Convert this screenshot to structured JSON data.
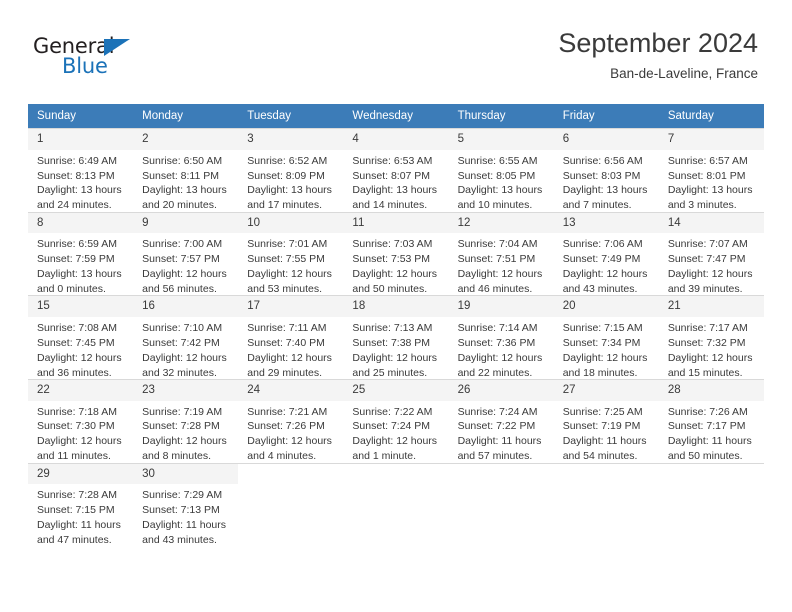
{
  "brand": {
    "name_part1": "General",
    "name_part2": "Blue",
    "triangle_color": "#1b72b8"
  },
  "header": {
    "title": "September 2024",
    "subtitle": "Ban-de-Laveline, France"
  },
  "colors": {
    "header_row_bg": "#3c7cb8",
    "header_row_text": "#ffffff",
    "daynum_bg": "#f4f4f4",
    "cell_text": "#3a3a3a",
    "grid_line": "#d9d9d9"
  },
  "weekdays": [
    "Sunday",
    "Monday",
    "Tuesday",
    "Wednesday",
    "Thursday",
    "Friday",
    "Saturday"
  ],
  "weeks": [
    [
      {
        "day": "1",
        "sunrise": "Sunrise: 6:49 AM",
        "sunset": "Sunset: 8:13 PM",
        "daylight_line1": "Daylight: 13 hours",
        "daylight_line2": "and 24 minutes."
      },
      {
        "day": "2",
        "sunrise": "Sunrise: 6:50 AM",
        "sunset": "Sunset: 8:11 PM",
        "daylight_line1": "Daylight: 13 hours",
        "daylight_line2": "and 20 minutes."
      },
      {
        "day": "3",
        "sunrise": "Sunrise: 6:52 AM",
        "sunset": "Sunset: 8:09 PM",
        "daylight_line1": "Daylight: 13 hours",
        "daylight_line2": "and 17 minutes."
      },
      {
        "day": "4",
        "sunrise": "Sunrise: 6:53 AM",
        "sunset": "Sunset: 8:07 PM",
        "daylight_line1": "Daylight: 13 hours",
        "daylight_line2": "and 14 minutes."
      },
      {
        "day": "5",
        "sunrise": "Sunrise: 6:55 AM",
        "sunset": "Sunset: 8:05 PM",
        "daylight_line1": "Daylight: 13 hours",
        "daylight_line2": "and 10 minutes."
      },
      {
        "day": "6",
        "sunrise": "Sunrise: 6:56 AM",
        "sunset": "Sunset: 8:03 PM",
        "daylight_line1": "Daylight: 13 hours",
        "daylight_line2": "and 7 minutes."
      },
      {
        "day": "7",
        "sunrise": "Sunrise: 6:57 AM",
        "sunset": "Sunset: 8:01 PM",
        "daylight_line1": "Daylight: 13 hours",
        "daylight_line2": "and 3 minutes."
      }
    ],
    [
      {
        "day": "8",
        "sunrise": "Sunrise: 6:59 AM",
        "sunset": "Sunset: 7:59 PM",
        "daylight_line1": "Daylight: 13 hours",
        "daylight_line2": "and 0 minutes."
      },
      {
        "day": "9",
        "sunrise": "Sunrise: 7:00 AM",
        "sunset": "Sunset: 7:57 PM",
        "daylight_line1": "Daylight: 12 hours",
        "daylight_line2": "and 56 minutes."
      },
      {
        "day": "10",
        "sunrise": "Sunrise: 7:01 AM",
        "sunset": "Sunset: 7:55 PM",
        "daylight_line1": "Daylight: 12 hours",
        "daylight_line2": "and 53 minutes."
      },
      {
        "day": "11",
        "sunrise": "Sunrise: 7:03 AM",
        "sunset": "Sunset: 7:53 PM",
        "daylight_line1": "Daylight: 12 hours",
        "daylight_line2": "and 50 minutes."
      },
      {
        "day": "12",
        "sunrise": "Sunrise: 7:04 AM",
        "sunset": "Sunset: 7:51 PM",
        "daylight_line1": "Daylight: 12 hours",
        "daylight_line2": "and 46 minutes."
      },
      {
        "day": "13",
        "sunrise": "Sunrise: 7:06 AM",
        "sunset": "Sunset: 7:49 PM",
        "daylight_line1": "Daylight: 12 hours",
        "daylight_line2": "and 43 minutes."
      },
      {
        "day": "14",
        "sunrise": "Sunrise: 7:07 AM",
        "sunset": "Sunset: 7:47 PM",
        "daylight_line1": "Daylight: 12 hours",
        "daylight_line2": "and 39 minutes."
      }
    ],
    [
      {
        "day": "15",
        "sunrise": "Sunrise: 7:08 AM",
        "sunset": "Sunset: 7:45 PM",
        "daylight_line1": "Daylight: 12 hours",
        "daylight_line2": "and 36 minutes."
      },
      {
        "day": "16",
        "sunrise": "Sunrise: 7:10 AM",
        "sunset": "Sunset: 7:42 PM",
        "daylight_line1": "Daylight: 12 hours",
        "daylight_line2": "and 32 minutes."
      },
      {
        "day": "17",
        "sunrise": "Sunrise: 7:11 AM",
        "sunset": "Sunset: 7:40 PM",
        "daylight_line1": "Daylight: 12 hours",
        "daylight_line2": "and 29 minutes."
      },
      {
        "day": "18",
        "sunrise": "Sunrise: 7:13 AM",
        "sunset": "Sunset: 7:38 PM",
        "daylight_line1": "Daylight: 12 hours",
        "daylight_line2": "and 25 minutes."
      },
      {
        "day": "19",
        "sunrise": "Sunrise: 7:14 AM",
        "sunset": "Sunset: 7:36 PM",
        "daylight_line1": "Daylight: 12 hours",
        "daylight_line2": "and 22 minutes."
      },
      {
        "day": "20",
        "sunrise": "Sunrise: 7:15 AM",
        "sunset": "Sunset: 7:34 PM",
        "daylight_line1": "Daylight: 12 hours",
        "daylight_line2": "and 18 minutes."
      },
      {
        "day": "21",
        "sunrise": "Sunrise: 7:17 AM",
        "sunset": "Sunset: 7:32 PM",
        "daylight_line1": "Daylight: 12 hours",
        "daylight_line2": "and 15 minutes."
      }
    ],
    [
      {
        "day": "22",
        "sunrise": "Sunrise: 7:18 AM",
        "sunset": "Sunset: 7:30 PM",
        "daylight_line1": "Daylight: 12 hours",
        "daylight_line2": "and 11 minutes."
      },
      {
        "day": "23",
        "sunrise": "Sunrise: 7:19 AM",
        "sunset": "Sunset: 7:28 PM",
        "daylight_line1": "Daylight: 12 hours",
        "daylight_line2": "and 8 minutes."
      },
      {
        "day": "24",
        "sunrise": "Sunrise: 7:21 AM",
        "sunset": "Sunset: 7:26 PM",
        "daylight_line1": "Daylight: 12 hours",
        "daylight_line2": "and 4 minutes."
      },
      {
        "day": "25",
        "sunrise": "Sunrise: 7:22 AM",
        "sunset": "Sunset: 7:24 PM",
        "daylight_line1": "Daylight: 12 hours",
        "daylight_line2": "and 1 minute."
      },
      {
        "day": "26",
        "sunrise": "Sunrise: 7:24 AM",
        "sunset": "Sunset: 7:22 PM",
        "daylight_line1": "Daylight: 11 hours",
        "daylight_line2": "and 57 minutes."
      },
      {
        "day": "27",
        "sunrise": "Sunrise: 7:25 AM",
        "sunset": "Sunset: 7:19 PM",
        "daylight_line1": "Daylight: 11 hours",
        "daylight_line2": "and 54 minutes."
      },
      {
        "day": "28",
        "sunrise": "Sunrise: 7:26 AM",
        "sunset": "Sunset: 7:17 PM",
        "daylight_line1": "Daylight: 11 hours",
        "daylight_line2": "and 50 minutes."
      }
    ],
    [
      {
        "day": "29",
        "sunrise": "Sunrise: 7:28 AM",
        "sunset": "Sunset: 7:15 PM",
        "daylight_line1": "Daylight: 11 hours",
        "daylight_line2": "and 47 minutes."
      },
      {
        "day": "30",
        "sunrise": "Sunrise: 7:29 AM",
        "sunset": "Sunset: 7:13 PM",
        "daylight_line1": "Daylight: 11 hours",
        "daylight_line2": "and 43 minutes."
      },
      {
        "day": "",
        "sunrise": "",
        "sunset": "",
        "daylight_line1": "",
        "daylight_line2": ""
      },
      {
        "day": "",
        "sunrise": "",
        "sunset": "",
        "daylight_line1": "",
        "daylight_line2": ""
      },
      {
        "day": "",
        "sunrise": "",
        "sunset": "",
        "daylight_line1": "",
        "daylight_line2": ""
      },
      {
        "day": "",
        "sunrise": "",
        "sunset": "",
        "daylight_line1": "",
        "daylight_line2": ""
      },
      {
        "day": "",
        "sunrise": "",
        "sunset": "",
        "daylight_line1": "",
        "daylight_line2": ""
      }
    ]
  ]
}
